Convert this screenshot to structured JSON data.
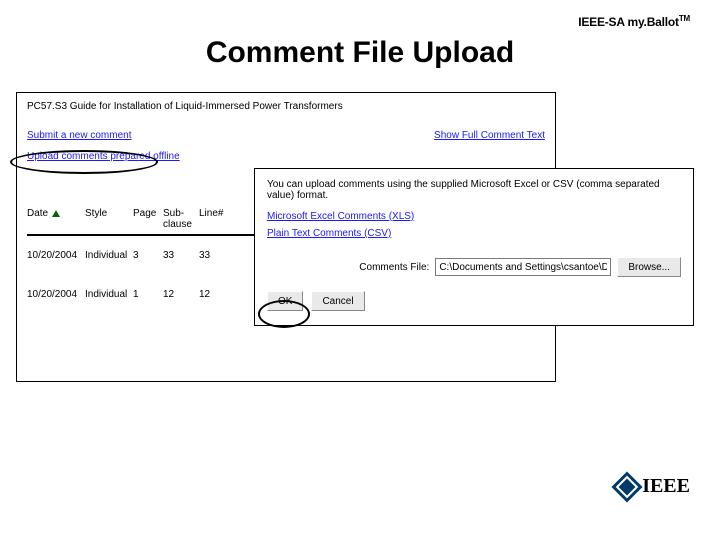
{
  "brand": {
    "prefix": "IEEE-SA my.",
    "name": "Ballot",
    "tm": "TM"
  },
  "title": "Comment File Upload",
  "bg": {
    "doc_title": "PC57.S3 Guide for Installation of Liquid-Immersed Power Transformers",
    "link_submit": "Submit a new comment",
    "link_showfull": "Show Full Comment Text",
    "link_upload_offline": "Upload comments prepared offline",
    "table": {
      "headers": {
        "date": "Date",
        "style": "Style",
        "page": "Page",
        "sub": "Sub-clause",
        "line": "Line#"
      },
      "rows": [
        {
          "date": "10/20/2004",
          "style": "Individual",
          "page": "3",
          "sub": "33",
          "line": "33"
        },
        {
          "date": "10/20/2004",
          "style": "Individual",
          "page": "1",
          "sub": "12",
          "line": "12"
        }
      ]
    }
  },
  "dialog": {
    "desc": "You can upload comments using the supplied Microsoft Excel or CSV (comma separated value) format.",
    "link_xls": "Microsoft Excel Comments (XLS)",
    "link_csv": "Plain Text Comments (CSV)",
    "file_label": "Comments File:",
    "file_value": "C:\\Documents and Settings\\csantoe\\Desktop\\com",
    "browse": "Browse...",
    "ok": "OK",
    "cancel": "Cancel"
  },
  "logo_text": "IEEE"
}
